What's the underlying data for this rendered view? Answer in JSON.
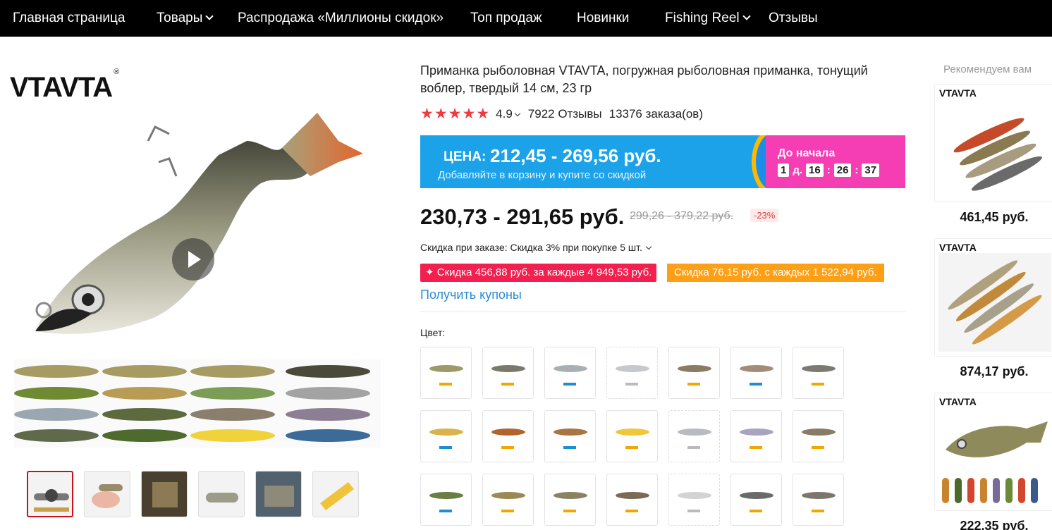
{
  "nav": {
    "items": [
      {
        "label": "Главная страница",
        "dropdown": false
      },
      {
        "label": "Товары",
        "dropdown": true
      },
      {
        "label": "Распродажа «Миллионы скидок»",
        "dropdown": false
      },
      {
        "label": "Топ продаж",
        "dropdown": false
      },
      {
        "label": "Новинки",
        "dropdown": false
      },
      {
        "label": "Fishing Reel",
        "dropdown": true
      },
      {
        "label": "Отзывы",
        "dropdown": false
      }
    ]
  },
  "gallery": {
    "brand": "VTAVTA",
    "brand_mark": "®",
    "thumbnail_count": 6
  },
  "product": {
    "title": "Приманка рыболовная VTAVTA, погружная рыболовная приманка, тонущий воблер, твердый 14 см, 23 гр",
    "rating": "4.9",
    "reviews": "7922 Отзывы",
    "orders": "13376 заказа(ов)",
    "promo": {
      "label": "ЦЕНА:",
      "price": "212,45 - 269,56 руб.",
      "subtitle": "Добавляйте в корзину и купите со скидкой",
      "countdown_title": "До начала",
      "days": "1",
      "days_unit": "д.",
      "hours": "16",
      "minutes": "26",
      "seconds": "37"
    },
    "price": "230,73 - 291,65 руб.",
    "old_price": "299,26 - 379,22 руб.",
    "discount": "-23%",
    "order_discount": "Скидка при заказе: Скидка 3% при покупке 5 шт.",
    "coupon_red": "✦ Скидка 456,88 руб. за каждые 4 949,53 руб.",
    "coupon_orange": "Скидка 76,15 руб. с каждых 1 522,94 руб.",
    "get_coupons": "Получить купоны",
    "color_label": "Цвет:"
  },
  "recommend": {
    "title": "Рекомендуем вам",
    "items": [
      {
        "logo": "VTAVTA",
        "price": "461,45 руб."
      },
      {
        "logo": "VTAVTA",
        "price": "874,17 руб."
      },
      {
        "logo": "VTAVTA",
        "price": "222,35 руб."
      }
    ]
  },
  "colors": {
    "accent_red": "#f21f4f",
    "promo_blue": "#1ba2e9",
    "promo_pink": "#f53db4",
    "coupon_orange": "#ff9f16",
    "link_blue": "#2a8bd3",
    "star": "#ef3b3b"
  }
}
